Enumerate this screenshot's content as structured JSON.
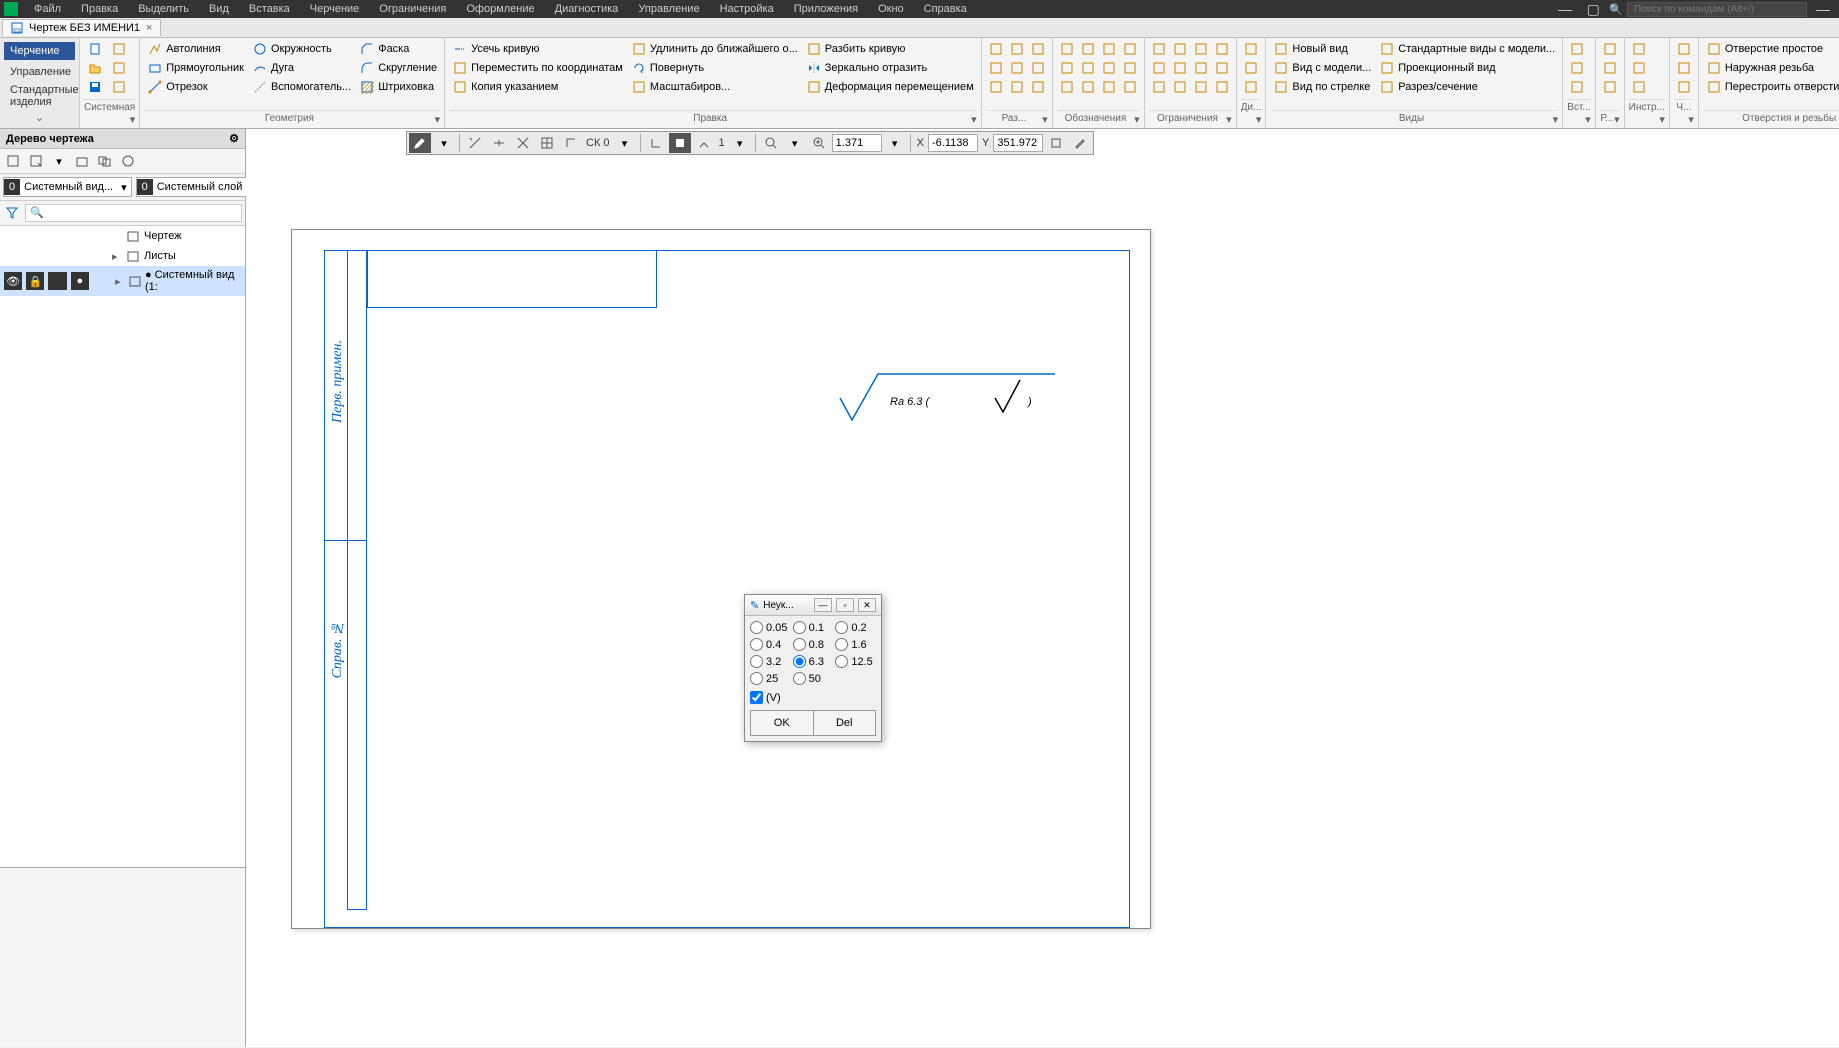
{
  "menubar": {
    "items": [
      "Файл",
      "Правка",
      "Выделить",
      "Вид",
      "Вставка",
      "Черчение",
      "Ограничения",
      "Оформление",
      "Диагностика",
      "Управление",
      "Настройка",
      "Приложения",
      "Окно",
      "Справка"
    ],
    "search_placeholder": "Поиск по командам (Alt+/)"
  },
  "doctab": {
    "title": "Чертеж БЕЗ ИМЕНИ1",
    "close": "×"
  },
  "ribbon_mode": {
    "active": "Черчение",
    "items": [
      "Управление",
      "Стандартные изделия"
    ]
  },
  "ribbon": {
    "groups": [
      {
        "label": "Системная",
        "cols": [
          [
            {
              "icon": "new",
              "txt": ""
            },
            {
              "icon": "open",
              "txt": ""
            },
            {
              "icon": "save",
              "txt": ""
            }
          ],
          [
            {
              "icon": "new2",
              "txt": ""
            },
            {
              "icon": "open2",
              "txt": ""
            },
            {
              "icon": "save2",
              "txt": ""
            }
          ]
        ]
      },
      {
        "label": "Геометрия",
        "cols": [
          [
            {
              "icon": "autoline",
              "txt": "Автолиния"
            },
            {
              "icon": "rect",
              "txt": "Прямоугольник"
            },
            {
              "icon": "segment",
              "txt": "Отрезок"
            }
          ],
          [
            {
              "icon": "circle",
              "txt": "Окружность"
            },
            {
              "icon": "arc",
              "txt": "Дуга"
            },
            {
              "icon": "auxline",
              "txt": "Вспомогатель..."
            }
          ],
          [
            {
              "icon": "chamfer",
              "txt": "Фаска"
            },
            {
              "icon": "fillet",
              "txt": "Скругление"
            },
            {
              "icon": "hatch",
              "txt": "Штриховка"
            }
          ]
        ]
      },
      {
        "label": "Правка",
        "cols": [
          [
            {
              "icon": "trim",
              "txt": "Усечь кривую"
            },
            {
              "icon": "movecoord",
              "txt": "Переместить по координатам"
            },
            {
              "icon": "copyptr",
              "txt": "Копия указанием"
            }
          ],
          [
            {
              "icon": "extend",
              "txt": "Удлинить до ближайшего о..."
            },
            {
              "icon": "rotate",
              "txt": "Повернуть"
            },
            {
              "icon": "scale",
              "txt": "Масштабиров..."
            }
          ],
          [
            {
              "icon": "split",
              "txt": "Разбить кривую"
            },
            {
              "icon": "mirror",
              "txt": "Зеркально отразить"
            },
            {
              "icon": "deform",
              "txt": "Деформация перемещением"
            }
          ]
        ]
      },
      {
        "label": "Раз...",
        "iconrows": [
          [
            "d1",
            "d2",
            "d3"
          ],
          [
            "d4",
            "d5",
            "d6"
          ],
          [
            "d7",
            "d8",
            "d9"
          ]
        ]
      },
      {
        "label": "Обозначения",
        "iconrows": [
          [
            "o1",
            "o2",
            "o3",
            "o4"
          ],
          [
            "o5",
            "o6",
            "o7",
            "o8"
          ],
          [
            "o9",
            "o10",
            "o11",
            "o12"
          ]
        ]
      },
      {
        "label": "Ограничения",
        "iconrows": [
          [
            "c1",
            "c2",
            "c3",
            "c4"
          ],
          [
            "c5",
            "c6",
            "c7",
            "c8"
          ],
          [
            "c9",
            "c10",
            "c11",
            "c12"
          ]
        ]
      },
      {
        "label": "Ди...",
        "iconrows": [
          [
            "g1"
          ],
          [
            "g2"
          ],
          [
            "g3"
          ]
        ]
      },
      {
        "label": "Виды",
        "cols": [
          [
            {
              "icon": "newview",
              "txt": "Новый вид"
            },
            {
              "icon": "modelview",
              "txt": "Вид с модели..."
            },
            {
              "icon": "arrowview",
              "txt": "Вид по стрелке"
            }
          ],
          [
            {
              "icon": "stdviews",
              "txt": "Стандартные виды с модели..."
            },
            {
              "icon": "projview",
              "txt": "Проекционный вид"
            },
            {
              "icon": "section",
              "txt": "Разрез/сечение"
            }
          ]
        ]
      },
      {
        "label": "Вст...",
        "iconrows": [
          [
            "v1"
          ],
          [
            "v2"
          ],
          [
            "v3"
          ]
        ]
      },
      {
        "label": "Р...",
        "iconrows": [
          [
            "r1"
          ],
          [
            "r2"
          ],
          [
            "r3"
          ]
        ]
      },
      {
        "label": "Инстр...",
        "iconrows": [
          [
            "i1"
          ],
          [
            "i2"
          ],
          [
            "i3"
          ]
        ]
      },
      {
        "label": "Ч...",
        "iconrows": [
          [
            "h1"
          ],
          [
            "h2"
          ],
          [
            "h3"
          ]
        ]
      },
      {
        "label": "Отверстия и резьбы",
        "cols": [
          [
            {
              "icon": "hole",
              "txt": "Отверстие простое"
            },
            {
              "icon": "thread",
              "txt": "Наружная резьба"
            },
            {
              "icon": "rebuild",
              "txt": "Перестроить отверстия и из..."
            }
          ]
        ]
      }
    ]
  },
  "sidebar": {
    "title": "Дерево чертежа",
    "dd1_num": "0",
    "dd1_text": "Системный вид...",
    "dd2_num": "0",
    "dd2_text": "Системный слой",
    "tree": [
      {
        "level": 0,
        "expand": "",
        "icon": "doc",
        "text": "Чертеж"
      },
      {
        "level": 0,
        "expand": "▸",
        "icon": "sheets",
        "text": "Листы"
      },
      {
        "level": 0,
        "expand": "▸",
        "icon": "view",
        "text": "Системный вид (1:",
        "sel": true,
        "stat": [
          "👁",
          "🔒",
          "",
          "●"
        ]
      }
    ]
  },
  "floating_toolbar": {
    "cs_label": "СК 0",
    "step_label": "1",
    "zoom": "1.371",
    "x_label": "X",
    "x_val": "-6.1138",
    "y_label": "Y",
    "y_val": "351.972"
  },
  "sheet": {
    "side_text1": "Перв. примен.",
    "side_text2": "Справ. №"
  },
  "roughness": {
    "text": "Ra 6.3 ( √ )"
  },
  "dialog": {
    "title": "Неук...",
    "options": [
      "0.05",
      "0.1",
      "0.2",
      "0.4",
      "0.8",
      "1.6",
      "3.2",
      "6.3",
      "12.5",
      "25",
      "50"
    ],
    "selected": "6.3",
    "checkbox_label": "(V)",
    "checkbox_checked": true,
    "ok": "OK",
    "del": "Del"
  }
}
